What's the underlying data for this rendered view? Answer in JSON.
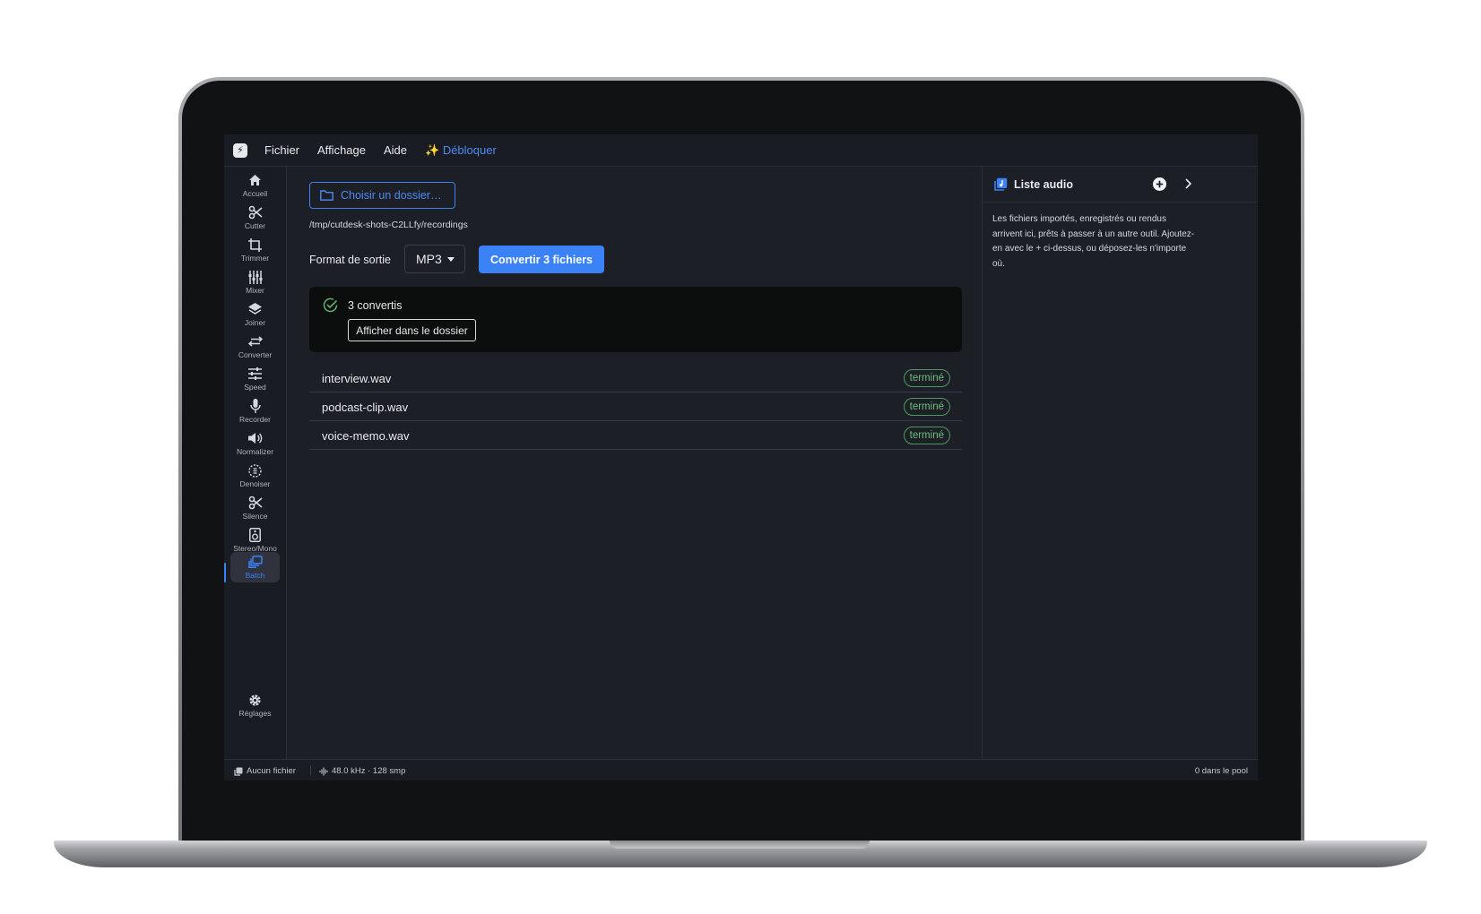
{
  "menubar": {
    "items": [
      "Fichier",
      "Affichage",
      "Aide"
    ],
    "unlock": "✨ Débloquer",
    "accent": "#3b82f6"
  },
  "sidebar": {
    "tools": [
      {
        "label": "Accueil",
        "icon": "home-icon"
      },
      {
        "label": "Cutter",
        "icon": "scissors-icon"
      },
      {
        "label": "Trimmer",
        "icon": "crop-icon"
      },
      {
        "label": "Mixer",
        "icon": "sliders-icon"
      },
      {
        "label": "Joiner",
        "icon": "layers-icon"
      },
      {
        "label": "Converter",
        "icon": "swap-icon"
      },
      {
        "label": "Speed",
        "icon": "tune-icon"
      },
      {
        "label": "Recorder",
        "icon": "mic-icon"
      },
      {
        "label": "Normalizer",
        "icon": "volume-icon"
      },
      {
        "label": "Denoiser",
        "icon": "denoise-icon"
      },
      {
        "label": "Silence",
        "icon": "scissors-icon"
      },
      {
        "label": "Stereo/Mono",
        "icon": "speaker-icon"
      },
      {
        "label": "Batch",
        "icon": "batch-icon",
        "active": true
      }
    ],
    "settings_label": "Réglages"
  },
  "main": {
    "choose_folder": "Choisir un dossier…",
    "path": "/tmp/cutdesk-shots-C2LLfy/recordings",
    "format_label": "Format de sortie",
    "format_value": "MP3",
    "convert_button": "Convertir 3 fichiers",
    "result": {
      "message": "3 convertis",
      "show_in_folder": "Afficher dans le dossier",
      "success_color": "#6dbb7c"
    },
    "files": [
      {
        "name": "interview.wav",
        "status": "terminé"
      },
      {
        "name": "podcast-clip.wav",
        "status": "terminé"
      },
      {
        "name": "voice-memo.wav",
        "status": "terminé"
      }
    ]
  },
  "right_panel": {
    "title": "Liste audio",
    "description": "Les fichiers importés, enregistrés ou rendus arrivent ici, prêts à passer à un autre outil. Ajoutez-en avec le + ci-dessus, ou déposez-les n'importe où."
  },
  "statusbar": {
    "file": "Aucun fichier",
    "audio": "48.0 kHz · 128 smp",
    "pool": "0 dans le pool"
  }
}
